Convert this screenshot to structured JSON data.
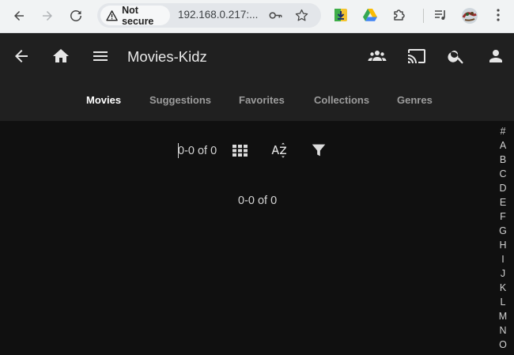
{
  "browser": {
    "security_label": "Not secure",
    "url": "192.168.0.217:...",
    "icons": [
      "back-arrow-icon",
      "forward-arrow-icon",
      "reload-icon",
      "warning-icon",
      "key-icon",
      "star-icon",
      "download-extension-icon",
      "google-drive-icon",
      "extensions-puzzle-icon",
      "media-queue-icon",
      "profile-avatar-icon",
      "kebab-menu-icon"
    ]
  },
  "header": {
    "title": "Movies-Kidz",
    "icons": [
      "back-arrow-icon",
      "home-icon",
      "menu-icon",
      "users-icon",
      "cast-icon",
      "search-icon",
      "person-icon"
    ]
  },
  "tabs": [
    {
      "label": "Movies",
      "active": true
    },
    {
      "label": "Suggestions",
      "active": false
    },
    {
      "label": "Favorites",
      "active": false
    },
    {
      "label": "Collections",
      "active": false
    },
    {
      "label": "Genres",
      "active": false
    }
  ],
  "toolbar": {
    "pager_text": "0-0 of 0",
    "icons": [
      "grid-view-icon",
      "sort-az-icon",
      "filter-icon"
    ]
  },
  "content": {
    "pager_text": "0-0 of 0"
  },
  "alpha_index": [
    "#",
    "A",
    "B",
    "C",
    "D",
    "E",
    "F",
    "G",
    "H",
    "I",
    "J",
    "K",
    "L",
    "M",
    "N",
    "O"
  ],
  "colors": {
    "header_bg": "#202020",
    "page_bg": "#101010",
    "active_tab": "#ffffff",
    "inactive_tab": "#9c9c9c"
  }
}
